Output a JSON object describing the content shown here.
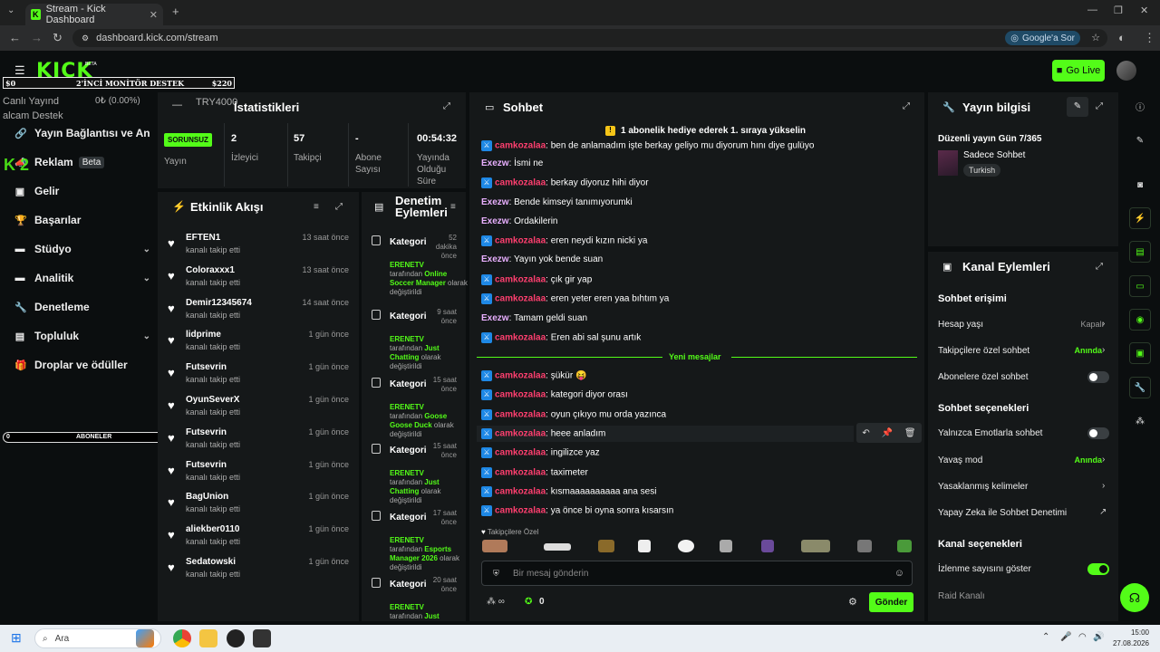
{
  "browser": {
    "tab_title": "Stream - Kick Dashboard",
    "url": "dashboard.kick.com/stream",
    "google_btn": "Google'a Sor"
  },
  "header": {
    "logo": "KICK",
    "beta": "BETA",
    "go_live": "Go Live"
  },
  "overlays": {
    "goal_left": "$0",
    "goal_title": "2'İNCİ MONİTÖR DESTEK",
    "goal_right": "$220",
    "subs_left": "0",
    "subs_title": "ABONELER",
    "subs_right": "5",
    "ghost1": "Canlı Yayınd",
    "ghost2": "alcam Destek",
    "ghost3": "TRY4000",
    "ghost4": "0₺ (0.00%)",
    "ghost5": "K 2"
  },
  "sidebar": {
    "items": [
      {
        "label": "Yayın Bağlantısı ve Anahtar"
      },
      {
        "label": "Reklam",
        "badge": "Beta"
      },
      {
        "label": "Gelir"
      },
      {
        "label": "Başarılar"
      },
      {
        "label": "Stüdyo"
      },
      {
        "label": "Analitik"
      },
      {
        "label": "Denetleme"
      },
      {
        "label": "Topluluk"
      },
      {
        "label": "Droplar ve ödüller"
      }
    ]
  },
  "stats": {
    "title": "İstatistikleri",
    "items": [
      {
        "value": "SORUNSUZ",
        "label": "Yayın"
      },
      {
        "value": "2",
        "label": "İzleyici"
      },
      {
        "value": "57",
        "label": "Takipçi"
      },
      {
        "value": "-",
        "label": "Abone Sayısı"
      },
      {
        "value": "00:54:32",
        "label": "Yayında Olduğu Süre"
      }
    ]
  },
  "activity": {
    "title": "Etkinlik Akışı",
    "items": [
      {
        "name": "EFTEN1",
        "sub": "kanalı takip etti",
        "time": "13 saat önce"
      },
      {
        "name": "Coloraxxx1",
        "sub": "kanalı takip etti",
        "time": "13 saat önce"
      },
      {
        "name": "Demir12345674",
        "sub": "kanalı takip etti",
        "time": "14 saat önce"
      },
      {
        "name": "lidprime",
        "sub": "kanalı takip etti",
        "time": "1 gün önce"
      },
      {
        "name": "Futsevrin",
        "sub": "kanalı takip etti",
        "time": "1 gün önce"
      },
      {
        "name": "OyunSeverX",
        "sub": "kanalı takip etti",
        "time": "1 gün önce"
      },
      {
        "name": "Futsevrin",
        "sub": "kanalı takip etti",
        "time": "1 gün önce"
      },
      {
        "name": "Futsevrin",
        "sub": "kanalı takip etti",
        "time": "1 gün önce"
      },
      {
        "name": "BagUnion",
        "sub": "kanalı takip etti",
        "time": "1 gün önce"
      },
      {
        "name": "aliekber0110",
        "sub": "kanalı takip etti",
        "time": "1 gün önce"
      },
      {
        "name": "Sedatowski",
        "sub": "kanalı takip etti",
        "time": "1 gün önce"
      }
    ]
  },
  "moderation": {
    "title1": "Denetim",
    "title2": "Eylemleri",
    "items": [
      {
        "kind": "Kategori",
        "time": "52 dakika önce",
        "user": "ERENETV",
        "by": "tarafından",
        "cat": "Online Soccer Manager",
        "tail": "olarak değiştirildi"
      },
      {
        "kind": "Kategori",
        "time": "9 saat önce",
        "user": "ERENETV",
        "by": "tarafından",
        "cat": "Just Chatting",
        "tail": "olarak değiştirildi"
      },
      {
        "kind": "Kategori",
        "time": "15 saat önce",
        "user": "ERENETV",
        "by": "tarafından",
        "cat": "Goose Goose Duck",
        "tail": "olarak değiştirildi"
      },
      {
        "kind": "Kategori",
        "time": "15 saat önce",
        "user": "ERENETV",
        "by": "tarafından",
        "cat": "Just Chatting",
        "tail": "olarak değiştirildi"
      },
      {
        "kind": "Kategori",
        "time": "17 saat önce",
        "user": "ERENETV",
        "by": "tarafından",
        "cat": "Esports Manager 2026",
        "tail": "olarak değiştirildi"
      },
      {
        "kind": "Kategori",
        "time": "20 saat önce",
        "user": "ERENETV",
        "by": "tarafından",
        "cat": "Just",
        "tail": ""
      }
    ]
  },
  "chat": {
    "title": "Sohbet",
    "pinned": "1 abonelik hediye ederek 1. sıraya yükselin",
    "messages": [
      {
        "user": "camkozalaa",
        "text": "ben de anlamadım işte berkay geliyo mu diyorum hını diye gulüyo",
        "mod": true
      },
      {
        "user": "Exezw",
        "text": "İsmi ne",
        "mod": false
      },
      {
        "user": "camkozalaa",
        "text": "berkay diyoruz hihi diyor",
        "mod": true
      },
      {
        "user": "Exezw",
        "text": "Bende kimseyi tanımıyorumki",
        "mod": false
      },
      {
        "user": "Exezw",
        "text": "Ordakilerin",
        "mod": false
      },
      {
        "user": "camkozalaa",
        "text": "eren neydi kızın nicki ya",
        "mod": true
      },
      {
        "user": "Exezw",
        "text": "Yayın yok bende suan",
        "mod": false
      },
      {
        "user": "camkozalaa",
        "text": "çık gir yap",
        "mod": true
      },
      {
        "user": "camkozalaa",
        "text": "eren yeter eren yaa bıhtım ya",
        "mod": true
      },
      {
        "user": "Exezw",
        "text": "Tamam geldi suan",
        "mod": false
      },
      {
        "user": "camkozalaa",
        "text": "Eren abi sal şunu artık",
        "mod": true
      },
      {
        "user": "camkozalaa",
        "text": "şükür 😝",
        "mod": true
      },
      {
        "user": "camkozalaa",
        "text": "kategori diyor orası",
        "mod": true
      },
      {
        "user": "camkozalaa",
        "text": "oyun çıkıyo mu orda yazınca",
        "mod": true
      },
      {
        "user": "camkozalaa",
        "text": "heee anladım",
        "mod": true
      },
      {
        "user": "camkozalaa",
        "text": "ingilizce yaz",
        "mod": true
      },
      {
        "user": "camkozalaa",
        "text": "taximeter",
        "mod": true
      },
      {
        "user": "camkozalaa",
        "text": "kısmaaaaaaaaaa ana sesi",
        "mod": true
      },
      {
        "user": "camkozalaa",
        "text": "ya önce bi oyna sonra kısarsın",
        "mod": true
      }
    ],
    "new_messages": "Yeni mesajlar",
    "followers_only": "Takipçilere Özel",
    "input_placeholder": "Bir mesaj gönderin",
    "points": "0",
    "send": "Gönder"
  },
  "stream_info": {
    "title": "Yayın bilgisi",
    "stream_title": "Düzenli yayın Gün 7/365",
    "category": "Sadece Sohbet",
    "language": "Turkish"
  },
  "channel_actions": {
    "title": "Kanal Eylemleri",
    "sec_chat_access": "Sohbet erişimi",
    "account_age": "Hesap yaşı",
    "account_age_val": "Kapalı",
    "followers_chat": "Takipçilere özel sohbet",
    "followers_chat_val": "Anında",
    "subs_chat": "Abonelere özel sohbet",
    "sec_chat_opts": "Sohbet seçenekleri",
    "emote_only": "Yalnızca Emotlarla sohbet",
    "slow_mode": "Yavaş mod",
    "slow_mode_val": "Anında",
    "banned_words": "Yasaklanmış kelimeler",
    "ai_mod": "Yapay Zeka ile Sohbet Denetimi",
    "sec_channel_opts": "Kanal seçenekleri",
    "show_views": "İzlenme sayısını göster",
    "raid": "Raid Kanalı"
  },
  "taskbar": {
    "search": "Ara",
    "time": "15:00",
    "date": "27.08.2026"
  },
  "colors": {
    "accent": "#53fc18",
    "panel": "#151819",
    "bg": "#0b0e0f"
  }
}
